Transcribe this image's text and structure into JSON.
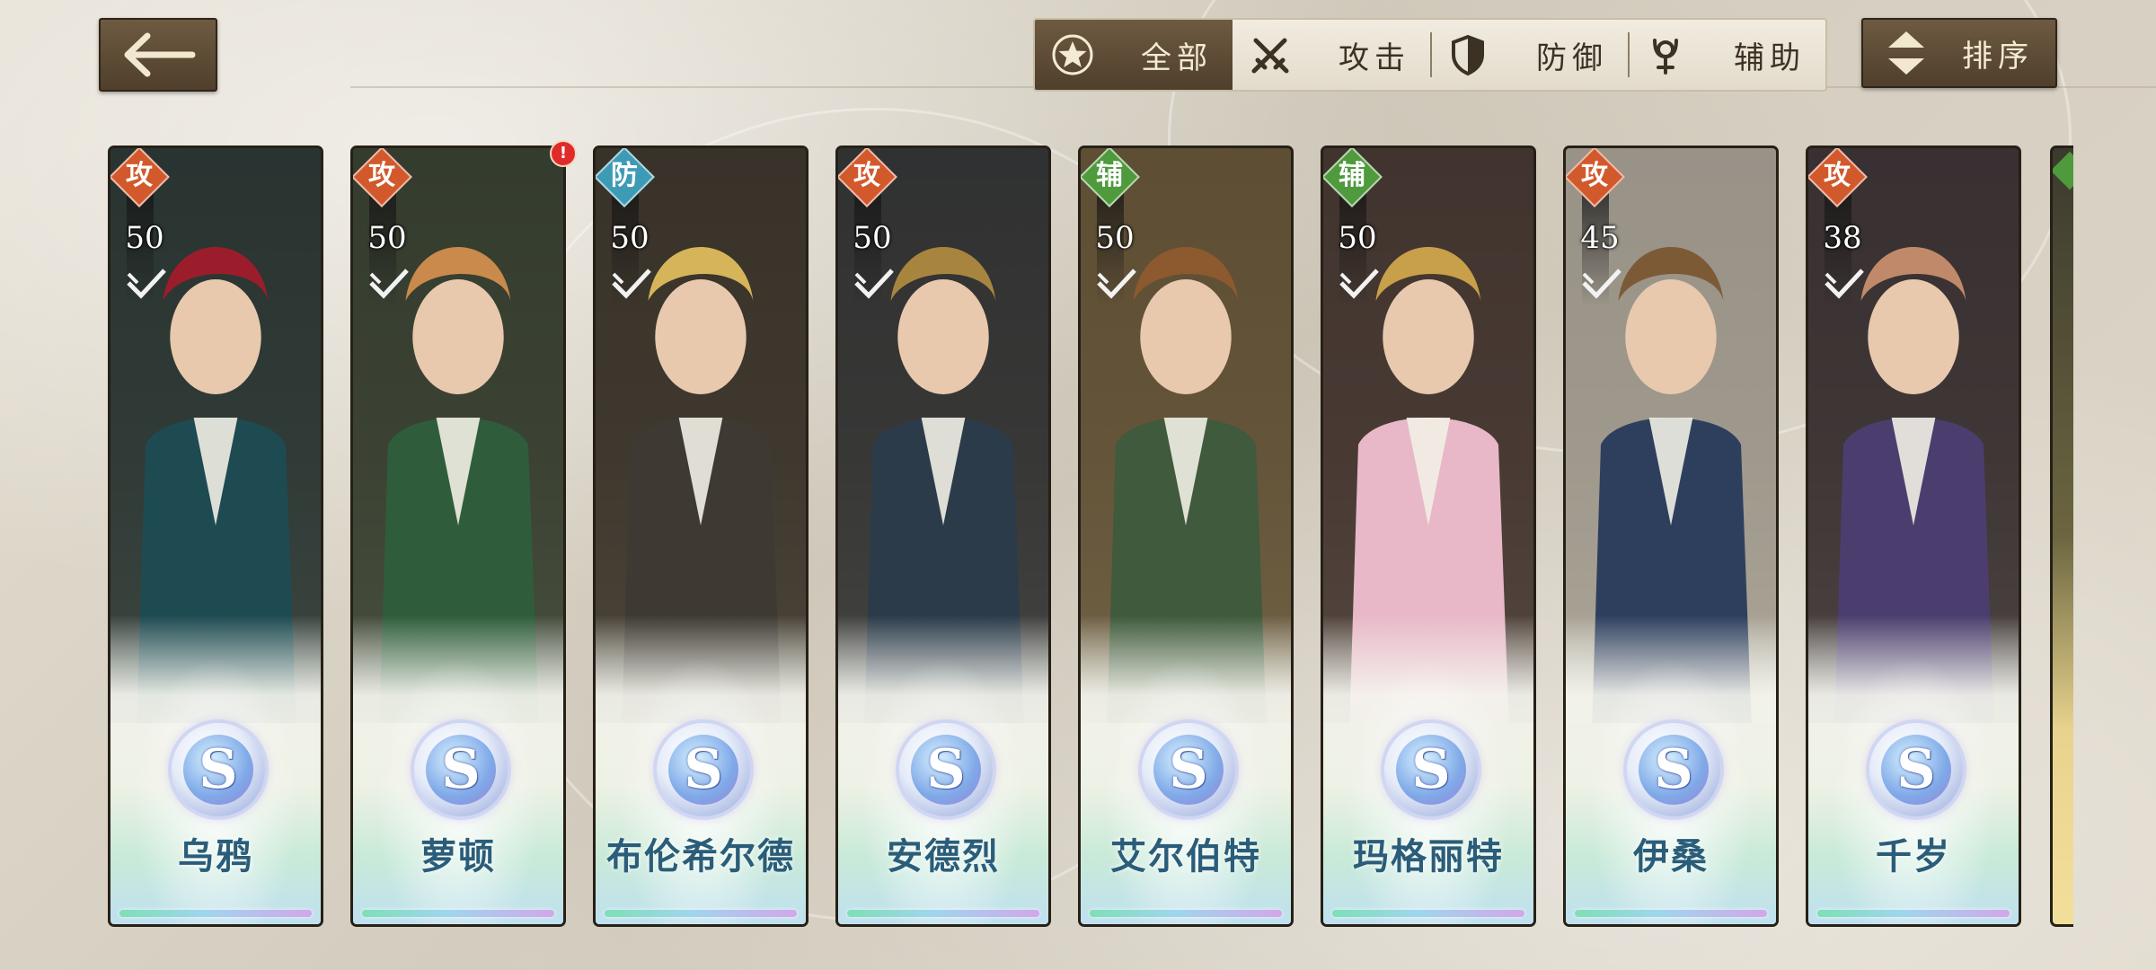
{
  "filters": {
    "tabs": [
      {
        "label": "全部",
        "icon": "star-icon",
        "active": true
      },
      {
        "label": "攻击",
        "icon": "crossed-swords-icon",
        "active": false
      },
      {
        "label": "防御",
        "icon": "shield-icon",
        "active": false
      },
      {
        "label": "辅助",
        "icon": "support-staff-icon",
        "active": false
      }
    ]
  },
  "sort": {
    "label": "排序",
    "icon": "sort-arrows-icon"
  },
  "notice_badge": "!",
  "rank_letter": "S",
  "role_colors": {
    "攻": "#d2592c",
    "防": "#3e9bb5",
    "辅": "#4e9a3c"
  },
  "characters": [
    {
      "name": "乌鸦",
      "role": "攻",
      "level": "50"
    },
    {
      "name": "萝顿",
      "role": "攻",
      "level": "50"
    },
    {
      "name": "布伦希尔德",
      "role": "防",
      "level": "50"
    },
    {
      "name": "安德烈",
      "role": "攻",
      "level": "50"
    },
    {
      "name": "艾尔伯特",
      "role": "辅",
      "level": "50"
    },
    {
      "name": "玛格丽特",
      "role": "辅",
      "level": "50"
    },
    {
      "name": "伊桑",
      "role": "攻",
      "level": "45"
    },
    {
      "name": "千岁",
      "role": "攻",
      "level": "38"
    }
  ]
}
